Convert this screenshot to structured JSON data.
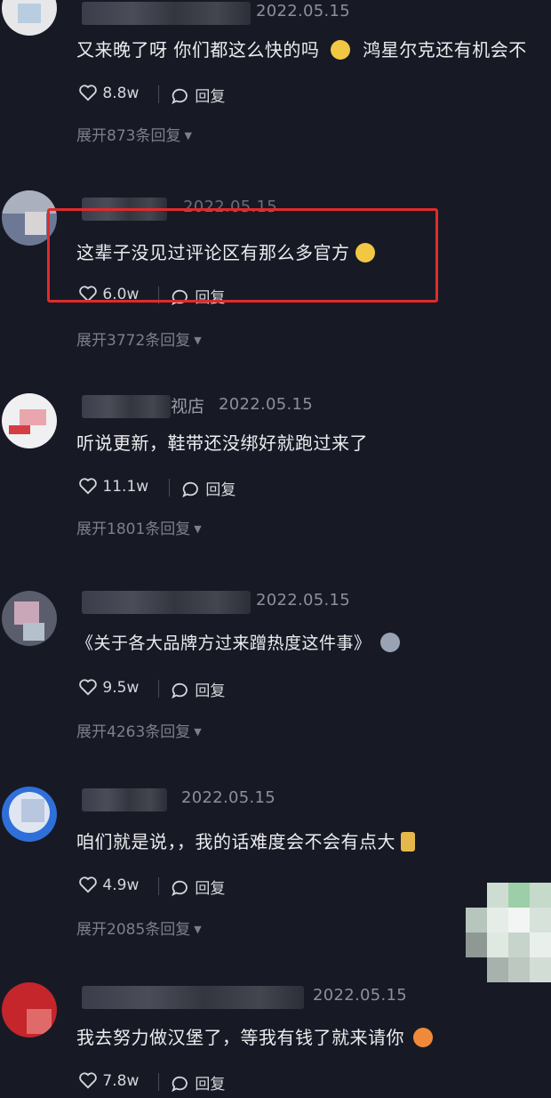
{
  "comments": [
    {
      "date": "2022.05.15",
      "text": "又来晚了呀 你们都这么快的吗",
      "text_tail": "鸿星尔克还有机会不",
      "emoji": "face-emoji",
      "likes": "8.8w",
      "reply_label": "回复",
      "expand": "展开873条回复"
    },
    {
      "date": "2022.05.15",
      "text": "这辈子没见过评论区有那么多官方",
      "emoji": "laughing-emoji",
      "likes": "6.0w",
      "reply_label": "回复",
      "expand": "展开3772条回复"
    },
    {
      "name_suffix": "视店",
      "date": "2022.05.15",
      "text": "听说更新，鞋带还没绑好就跑过来了",
      "likes": "11.1w",
      "reply_label": "回复",
      "expand": "展开1801条回复"
    },
    {
      "date": "2022.05.15",
      "text": "《关于各大品牌方过来蹭热度这件事》",
      "emoji": "husky-emoji",
      "likes": "9.5w",
      "reply_label": "回复",
      "expand": "展开4263条回复"
    },
    {
      "date": "2022.05.15",
      "text": "咱们就是说，，我的话难度会不会有点大",
      "emoji": "box-emoji",
      "likes": "4.9w",
      "reply_label": "回复",
      "expand": "展开2085条回复"
    },
    {
      "date": "2022.05.15",
      "text": "我去努力做汉堡了，等我有钱了就来请你",
      "emoji": "heart-eyes-emoji",
      "likes": "7.8w",
      "reply_label": "回复"
    }
  ],
  "colors": {
    "background": "#171a25",
    "highlight": "#e12a2a"
  }
}
